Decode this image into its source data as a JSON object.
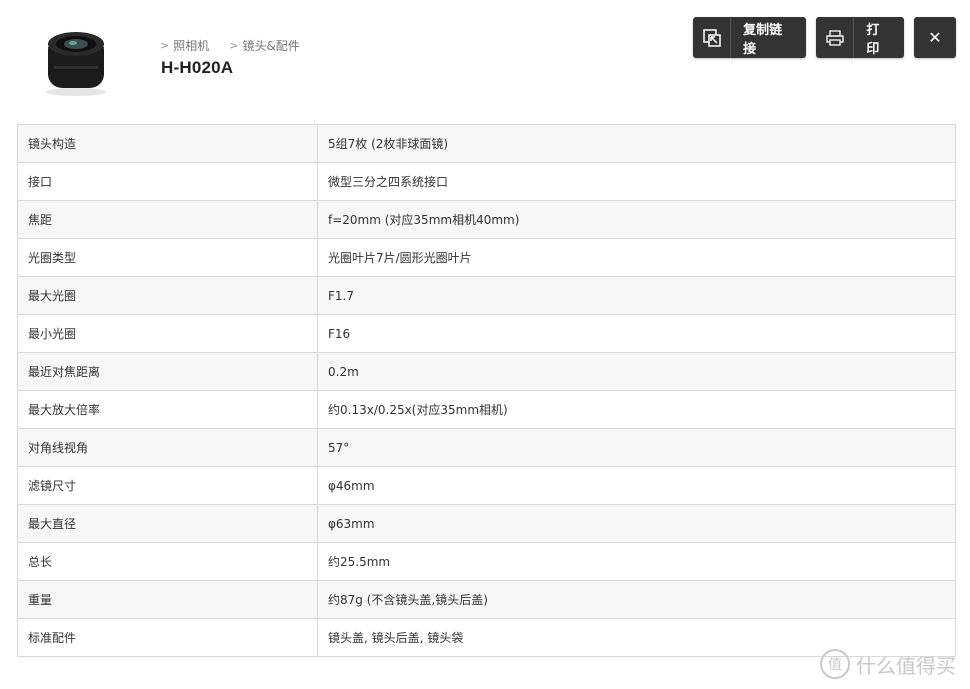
{
  "breadcrumb": [
    "照相机",
    "镜头&配件"
  ],
  "product": {
    "title": "H-H020A"
  },
  "actions": {
    "copy_label": "复制链接",
    "print_label": "打印",
    "close_symbol": "✕"
  },
  "specs": [
    {
      "label": "镜头构造",
      "value": "5组7枚 (2枚非球面镜)"
    },
    {
      "label": "接口",
      "value": "微型三分之四系统接口"
    },
    {
      "label": "焦距",
      "value": "f=20mm (对应35mm相机40mm)"
    },
    {
      "label": "光圈类型",
      "value": "光圈叶片7片/圆形光圈叶片"
    },
    {
      "label": "最大光圈",
      "value": "F1.7"
    },
    {
      "label": "最小光圈",
      "value": "F16"
    },
    {
      "label": "最近对焦距离",
      "value": "0.2m"
    },
    {
      "label": "最大放大倍率",
      "value": "约0.13x/0.25x(对应35mm相机)"
    },
    {
      "label": "对角线视角",
      "value": "57°"
    },
    {
      "label": "滤镜尺寸",
      "value": "φ46mm"
    },
    {
      "label": "最大直径",
      "value": "φ63mm"
    },
    {
      "label": "总长",
      "value": "约25.5mm"
    },
    {
      "label": "重量",
      "value": "约87g (不含镜头盖,镜头后盖)"
    },
    {
      "label": "标准配件",
      "value": "镜头盖, 镜头后盖, 镜头袋"
    }
  ],
  "watermark": {
    "badge": "值",
    "text": "什么值得买"
  },
  "colors": {
    "button_bg": "#333333",
    "row_alt": "#f7f7f7",
    "border": "#d9d9d9"
  },
  "icons": {
    "copy": "external-link-icon",
    "print": "printer-icon",
    "close": "close-icon"
  }
}
